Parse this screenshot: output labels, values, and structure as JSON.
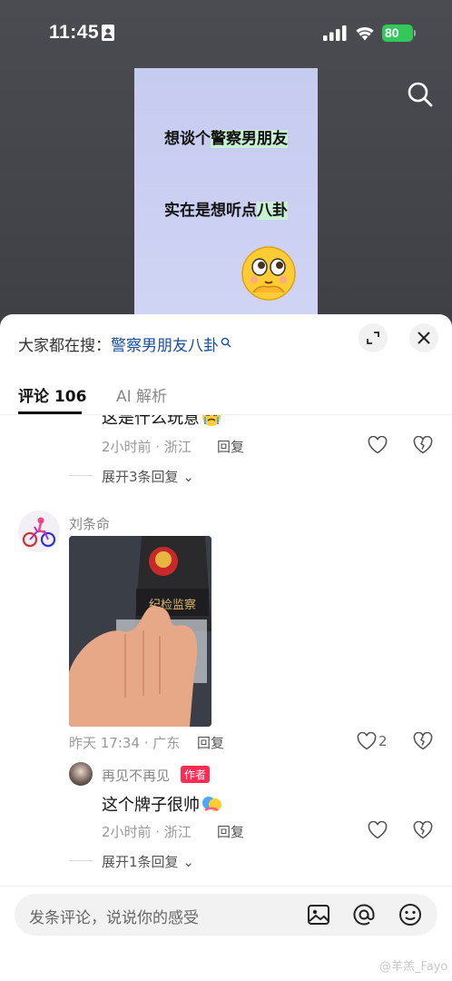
{
  "status_bar": {
    "time": "11:45",
    "battery": "80"
  },
  "video": {
    "line1_plain": "想谈个",
    "line1_highlight": "警察男朋友",
    "line2_plain": "实在是想听点",
    "line2_highlight": "八卦"
  },
  "sheet": {
    "hot_search_prefix": "大家都在搜：",
    "hot_search_keyword": "警察男朋友八卦",
    "tabs": [
      {
        "label": "评论 106"
      },
      {
        "label": "AI 解析"
      }
    ]
  },
  "comments": {
    "partial": {
      "text": "这是什么玩意",
      "meta": "2小时前 · 浙江",
      "reply_label": "回复",
      "expand_label": "展开3条回复"
    },
    "main": {
      "username": "刘条命",
      "photo_badge_text": "纪检监察",
      "meta": "昨天 17:34 · 广东",
      "reply_label": "回复",
      "like_count": "2"
    },
    "reply": {
      "username": "再见不再见",
      "author_badge": "作者",
      "text": "这个牌子很帅",
      "meta": "2小时前 · 浙江",
      "reply_label": "回复",
      "expand_label": "展开1条回复"
    }
  },
  "input": {
    "placeholder": "发条评论，说说你的感受"
  },
  "watermark": "@羊羔_Fayo",
  "colors": {
    "accent": "#fe2c55",
    "keyword": "#1b4e9a",
    "battery": "#34c759"
  }
}
